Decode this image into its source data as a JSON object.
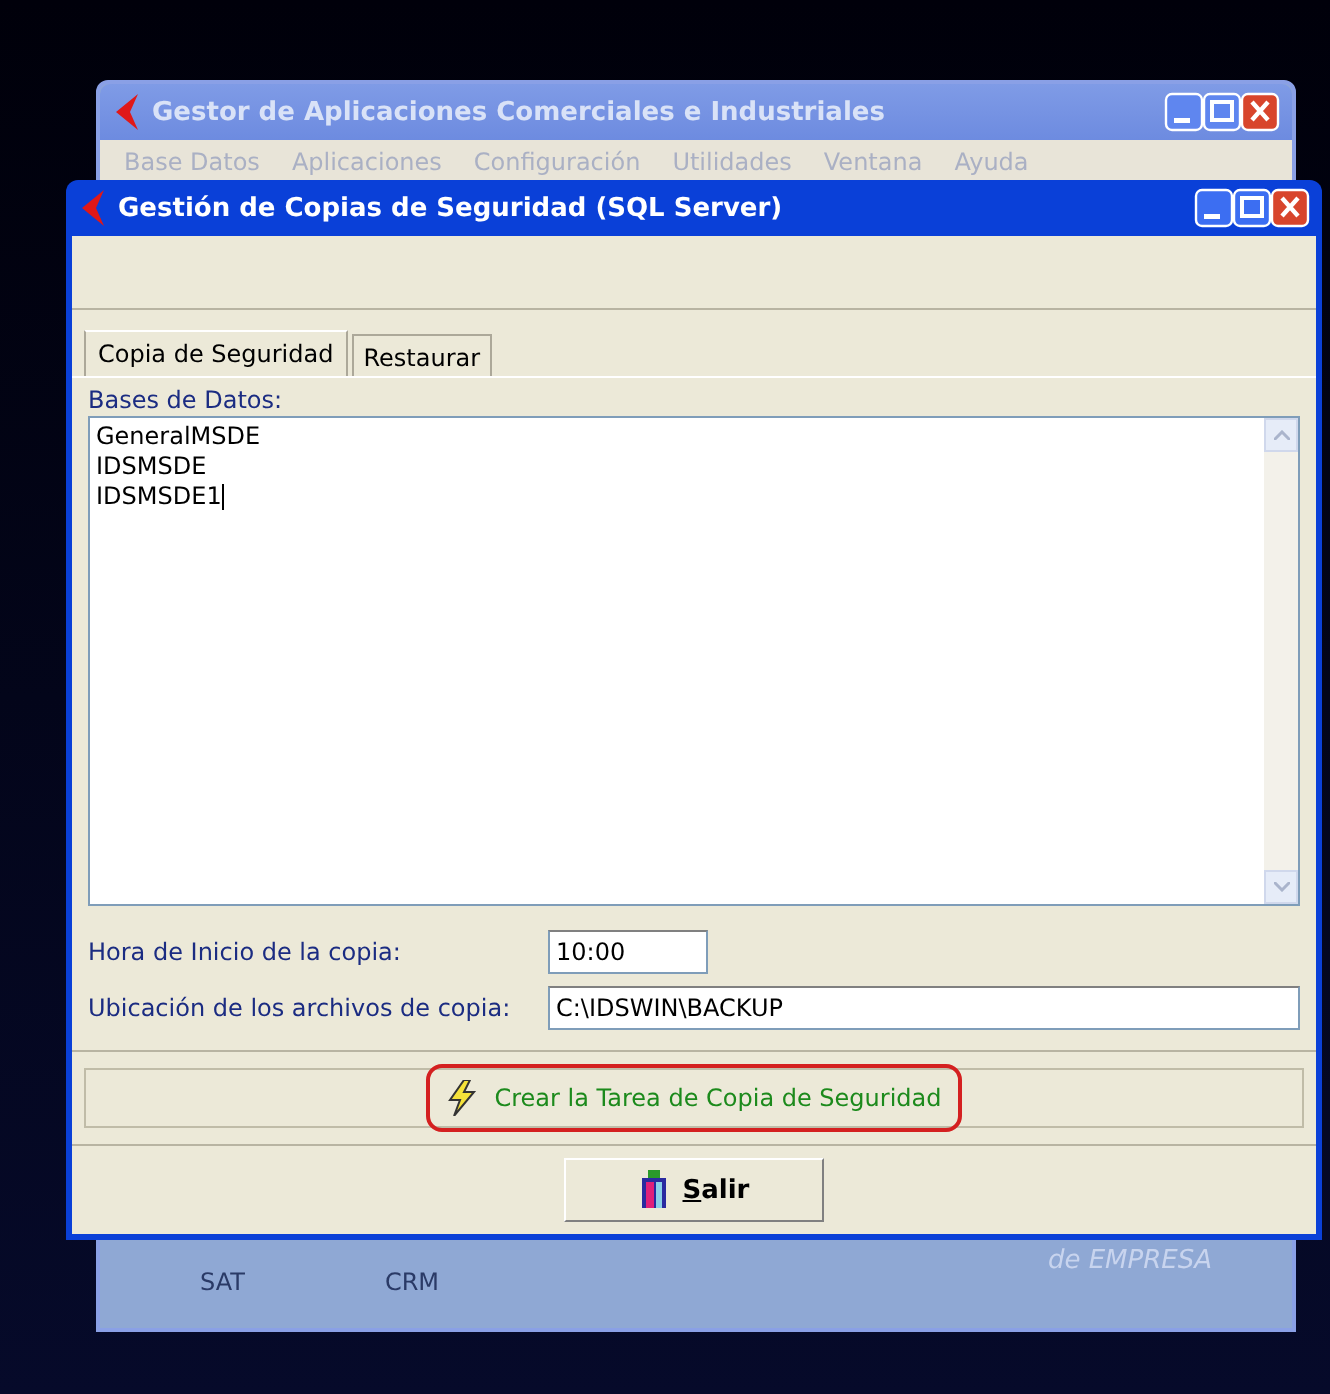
{
  "back_window": {
    "title": "Gestor de Aplicaciones Comerciales e Industriales",
    "menu": [
      "Base Datos",
      "Aplicaciones",
      "Configuración",
      "Utilidades",
      "Ventana",
      "Ayuda"
    ],
    "launchers": [
      "SAT",
      "CRM"
    ],
    "tagline": "de EMPRESA"
  },
  "dialog": {
    "title": "Gestión de Copias de Seguridad (SQL Server)",
    "tabs": [
      {
        "label": "Copia de Seguridad",
        "selected": true
      },
      {
        "label": "Restaurar",
        "selected": false
      }
    ],
    "databases_label": "Bases de Datos:",
    "databases": [
      "GeneralMSDE",
      "IDSMSDE",
      "IDSMSDE1"
    ],
    "fields": [
      {
        "label": "Hora de Inicio de la copia:",
        "value": "10:00",
        "wide": false
      },
      {
        "label": "Ubicación de los archivos de copia:",
        "value": "C:\\IDSWIN\\BACKUP",
        "wide": true
      }
    ],
    "create_button": {
      "label": "Crear la Tarea de Copia de Seguridad",
      "highlighted": true
    },
    "exit_button": {
      "label": "Salir",
      "underline_first": true
    }
  }
}
